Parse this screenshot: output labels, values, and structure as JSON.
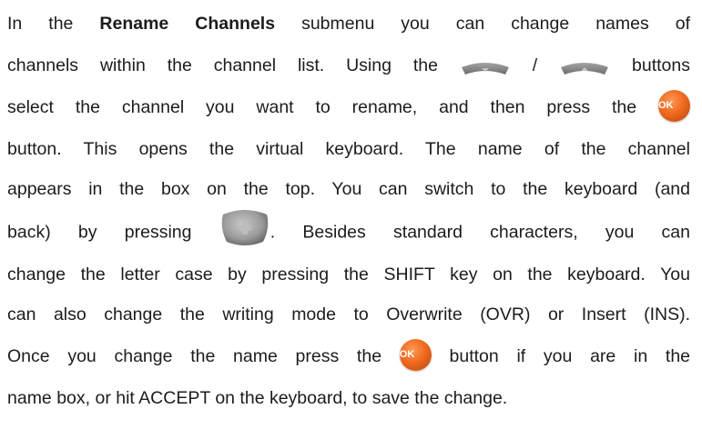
{
  "paragraph": {
    "l1_a": "In the ",
    "l1_bold": "Rename Channels",
    "l1_b": " submenu you can change names of",
    "l2_a": "channels within the channel list. Using the",
    "l2_slash": "/",
    "l2_b": "buttons",
    "l3_a": "select the channel you want to rename, and then press the",
    "l4": "button. This opens the virtual keyboard. The name of the channel",
    "l5": "appears in the box on the top. You can switch to the keyboard (and",
    "l6_a": "back) by pressing",
    "l6_b": ". Besides standard characters, you can",
    "l7": "change the letter case by pressing the SHIFT key on the keyboard. You",
    "l8": "can also change the writing mode to Overwrite (OVR) or Insert (INS).",
    "l9_a": "Once you change the name press the",
    "l9_b": "button if you are in the",
    "l10": "name box, or hit ACCEPT on the keyboard, to save the change."
  },
  "icons": {
    "down": "down-arrow-button-icon",
    "up": "up-arrow-button-icon",
    "ok": "ok-button-icon",
    "plus": "plus-button-icon",
    "ok_label": "OK"
  },
  "colors": {
    "text": "#1c1c1c",
    "button_grey": "#8e8e8e",
    "ok_orange": "#ef6a1f"
  }
}
